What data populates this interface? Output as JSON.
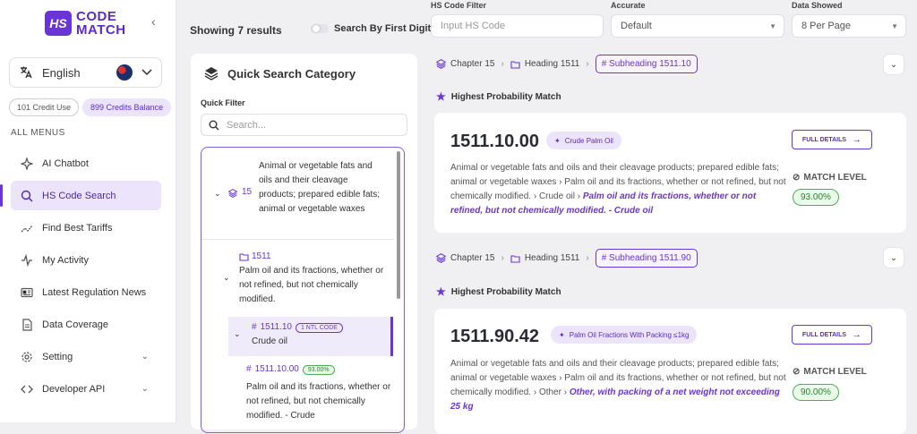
{
  "brand": {
    "badge": "HS",
    "line1": "CODE",
    "line2": "MATCH"
  },
  "language": {
    "label": "English"
  },
  "credits": {
    "used": "101 Credit Use",
    "balance": "899 Credits Balance"
  },
  "menu": {
    "section": "ALL MENUS",
    "items": [
      {
        "label": "AI Chatbot"
      },
      {
        "label": "HS Code Search"
      },
      {
        "label": "Find Best Tariffs"
      },
      {
        "label": "My Activity"
      },
      {
        "label": "Latest Regulation News"
      },
      {
        "label": "Data Coverage"
      },
      {
        "label": "Setting"
      },
      {
        "label": "Developer API"
      }
    ]
  },
  "topbar": {
    "showing": "Showing 7 results",
    "first_digit": "Search By First Digit",
    "filters": [
      {
        "label": "HS Code Filter",
        "placeholder": "Input HS Code"
      },
      {
        "label": "Accurate",
        "value": "Default"
      },
      {
        "label": "Data Showed",
        "value": "8 Per Page"
      }
    ]
  },
  "quick": {
    "title": "Quick Search Category",
    "filter_label": "Quick Filter",
    "search_placeholder": "Search...",
    "tree": {
      "n15_code": "15",
      "n15_text": "Animal or vegetable fats and oils and their cleavage products; prepared edible fats; animal or vegetable waxes",
      "n1511_code": "1511",
      "n1511_text": "Palm oil and its fractions, whether or not refined, but not chemically modified.",
      "n151110_code": "1511.10",
      "n151110_badge": "1 NTL CODE",
      "n151110_text": "Crude oil",
      "n15111000_code": "1511.10.00",
      "n15111000_pct": "93.00%",
      "n15111000_text": "Palm oil and its fractions, whether or not refined, but not chemically modified. - Crude"
    }
  },
  "results": [
    {
      "chapter": "Chapter 15",
      "heading": "Heading 1511",
      "subheading": "# Subheading 1511.10",
      "hpm": "Highest Probability Match",
      "code": "1511.10.00",
      "tag": "Crude Palm Oil",
      "desc_main": "Animal or vegetable fats and oils and their cleavage products; prepared edible fats; animal or vegetable waxes",
      "desc_mid": "Palm oil and its fractions, whether or not refined, but not chemically modified.",
      "desc_sub": "Crude oil",
      "desc_em": "Palm oil and its fractions, whether or not refined, but not chemically modified. - Crude oil",
      "full_details": "FULL DETAILS",
      "match_label": "MATCH LEVEL",
      "match_value": "93.00%"
    },
    {
      "chapter": "Chapter 15",
      "heading": "Heading 1511",
      "subheading": "# Subheading 1511.90",
      "hpm": "Highest Probability Match",
      "code": "1511.90.42",
      "tag": "Palm Oil Fractions With Packing ≤1kg",
      "desc_main": "Animal or vegetable fats and oils and their cleavage products; prepared edible fats; animal or vegetable waxes",
      "desc_mid": "Palm oil and its fractions, whether or not refined, but not chemically modified.",
      "desc_sub": "Other",
      "desc_em": "Other, with packing of a net weight not exceeding 25 kg",
      "full_details": "FULL DETAILS",
      "match_label": "MATCH LEVEL",
      "match_value": "90.00%"
    }
  ]
}
